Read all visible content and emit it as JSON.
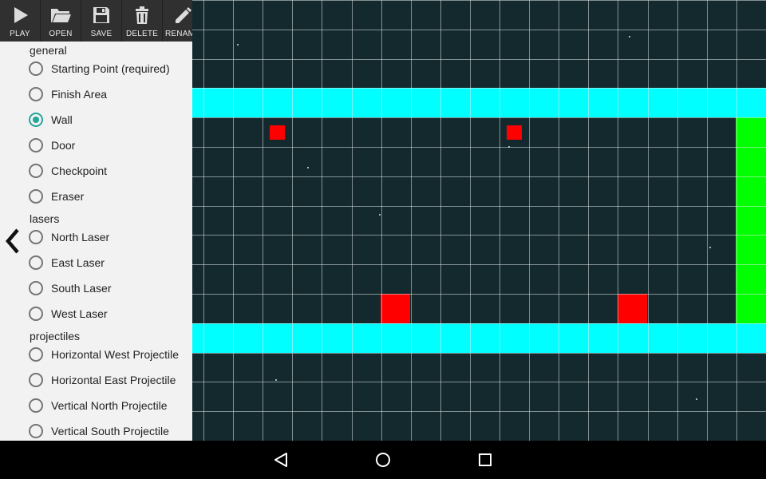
{
  "toolbar": {
    "buttons": [
      {
        "label": "PLAY",
        "icon": "play-icon"
      },
      {
        "label": "OPEN",
        "icon": "folder-icon"
      },
      {
        "label": "SAVE",
        "icon": "floppy-disk-icon"
      },
      {
        "label": "DELETE",
        "icon": "trash-icon"
      },
      {
        "label": "RENAME",
        "icon": "pencil-icon"
      }
    ]
  },
  "panel": {
    "sections": [
      {
        "title": "general",
        "options": [
          {
            "label": "Starting Point (required)",
            "selected": false
          },
          {
            "label": "Finish Area",
            "selected": false
          },
          {
            "label": "Wall",
            "selected": true
          },
          {
            "label": "Door",
            "selected": false
          },
          {
            "label": "Checkpoint",
            "selected": false
          },
          {
            "label": "Eraser",
            "selected": false
          }
        ]
      },
      {
        "title": "lasers",
        "options": [
          {
            "label": "North Laser",
            "selected": false
          },
          {
            "label": "East Laser",
            "selected": false
          },
          {
            "label": "South Laser",
            "selected": false
          },
          {
            "label": "West Laser",
            "selected": false
          }
        ]
      },
      {
        "title": "projectiles",
        "options": [
          {
            "label": "Horizontal West Projectile",
            "selected": false
          },
          {
            "label": "Horizontal East Projectile",
            "selected": false
          },
          {
            "label": "Vertical North Projectile",
            "selected": false
          },
          {
            "label": "Vertical South Projectile",
            "selected": false
          }
        ]
      }
    ],
    "collapse_icon": "chevron-left-icon"
  },
  "colors": {
    "accent": "#26a69a",
    "wall": "#00ffff",
    "finish_area": "#00ff00",
    "red_block": "#ff0000",
    "background": "#13292e"
  },
  "navbar": {
    "icons": [
      "back-triangle-icon",
      "home-circle-icon",
      "recents-square-icon"
    ]
  }
}
